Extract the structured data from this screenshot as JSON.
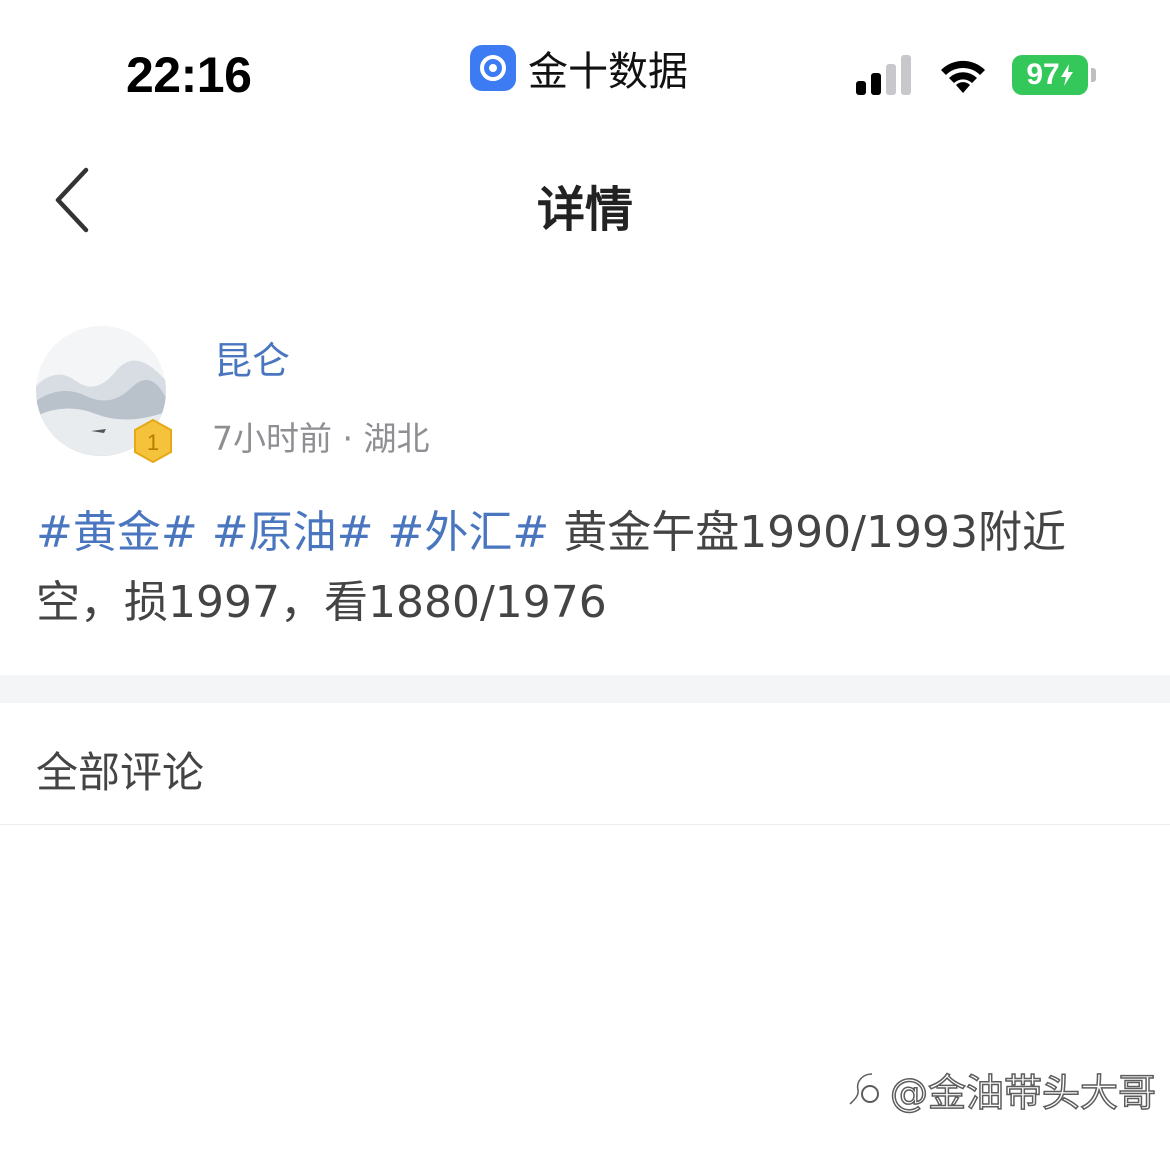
{
  "status_bar": {
    "time": "22:16",
    "app_name": "金十数据",
    "battery": "97",
    "icons": [
      "app-icon",
      "signal-icon",
      "wifi-icon",
      "battery-icon"
    ]
  },
  "nav": {
    "title": "详情",
    "back_icon": "chevron-left-icon"
  },
  "post": {
    "author": "昆仑",
    "level": "1",
    "time_ago": "7小时前",
    "separator": " · ",
    "location": "湖北",
    "tags": [
      "#黄金#",
      "#原油#",
      "#外汇#"
    ],
    "text": " 黄金午盘1990/1993附近空，损1997，看1880/1976"
  },
  "comments": {
    "title": "全部评论"
  },
  "watermark": {
    "text": "@金油带头大哥"
  },
  "colors": {
    "accent": "#4a76c0",
    "battery_green": "#34c759",
    "app_blue": "#3d7bf2",
    "section_bg": "#f4f5f7"
  }
}
